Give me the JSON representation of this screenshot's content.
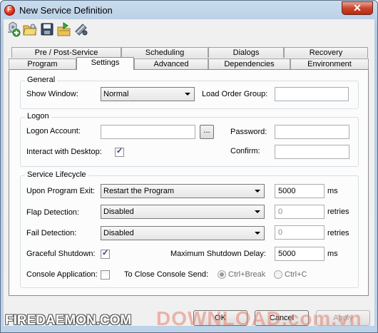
{
  "window": {
    "title": "New Service Definition",
    "close_label": "✕"
  },
  "toolbar": {
    "buttons": [
      "new-icon",
      "open-icon",
      "save-icon",
      "export-icon",
      "tools-icon"
    ]
  },
  "tabs": {
    "row1": [
      "Pre / Post-Service",
      "Scheduling",
      "Dialogs",
      "Recovery"
    ],
    "row2": [
      "Program",
      "Settings",
      "Advanced",
      "Dependencies",
      "Environment"
    ],
    "active": "Settings"
  },
  "general": {
    "title": "General",
    "show_window_label": "Show Window:",
    "show_window_value": "Normal",
    "load_order_label": "Load Order Group:",
    "load_order_value": ""
  },
  "logon": {
    "title": "Logon",
    "account_label": "Logon Account:",
    "account_value": "",
    "browse_label": "...",
    "password_label": "Password:",
    "interact_label": "Interact with Desktop:",
    "interact_checked": true,
    "confirm_label": "Confirm:"
  },
  "lifecycle": {
    "title": "Service Lifecycle",
    "upon_exit_label": "Upon Program Exit:",
    "upon_exit_value": "Restart the Program",
    "upon_exit_ms": "5000",
    "ms_label": "ms",
    "flap_label": "Flap Detection:",
    "flap_value": "Disabled",
    "flap_retries": "0",
    "retries_label": "retries",
    "fail_label": "Fail Detection:",
    "fail_value": "Disabled",
    "fail_retries": "0",
    "graceful_label": "Graceful Shutdown:",
    "graceful_checked": true,
    "max_delay_label": "Maximum Shutdown Delay:",
    "max_delay_value": "5000",
    "console_label": "Console Application:",
    "console_checked": false,
    "close_send_label": "To Close Console Send:",
    "ctrl_break_label": "Ctrl+Break",
    "ctrl_c_label": "Ctrl+C"
  },
  "buttons": {
    "ok": "OK",
    "cancel": "Cancel",
    "apply": "Apply"
  },
  "watermarks": {
    "left": "FIREDAEMON.COM",
    "right": "DOWNLOAD.com.vn"
  }
}
